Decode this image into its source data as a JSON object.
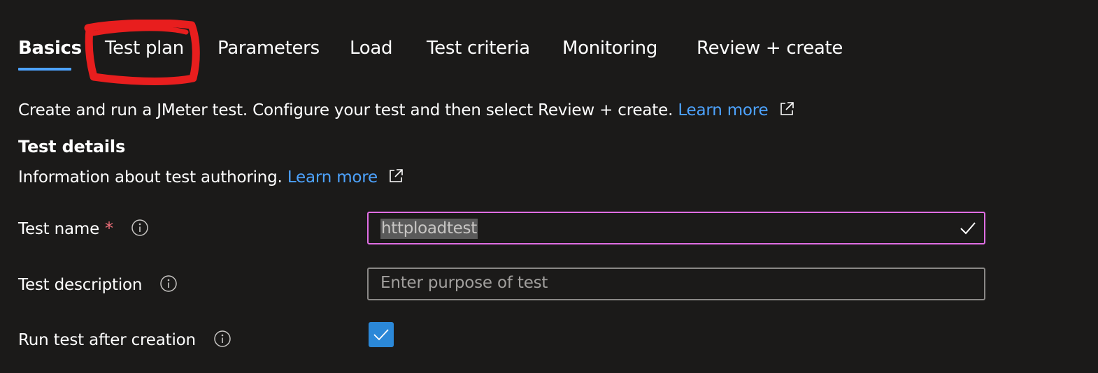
{
  "tabs": [
    {
      "label": "Basics",
      "active": true
    },
    {
      "label": "Test plan",
      "active": false
    },
    {
      "label": "Parameters",
      "active": false
    },
    {
      "label": "Load",
      "active": false
    },
    {
      "label": "Test criteria",
      "active": false
    },
    {
      "label": "Monitoring",
      "active": false
    },
    {
      "label": "Review + create",
      "active": false
    }
  ],
  "intro": {
    "text": "Create and run a JMeter test. Configure your test and then select Review + create.",
    "link": "Learn more"
  },
  "section": {
    "title": "Test details",
    "description": "Information about test authoring.",
    "link": "Learn more"
  },
  "form": {
    "test_name": {
      "label": "Test name",
      "required_mark": "*",
      "value": "httploadtest",
      "valid": true
    },
    "test_description": {
      "label": "Test description",
      "value": "",
      "placeholder": "Enter purpose of test"
    },
    "run_after_creation": {
      "label": "Run test after creation",
      "checked": true
    }
  },
  "colors": {
    "background": "#1b1a19",
    "accent": "#4da3ff",
    "link": "#4da3ff",
    "focus_border": "#e06ee4",
    "checkbox": "#2b88d8",
    "required": "#f1707b",
    "annotation": "#e81e1e"
  },
  "icons": {
    "external_link": "external-link-icon",
    "info": "info-icon",
    "valid": "checkmark-icon"
  }
}
